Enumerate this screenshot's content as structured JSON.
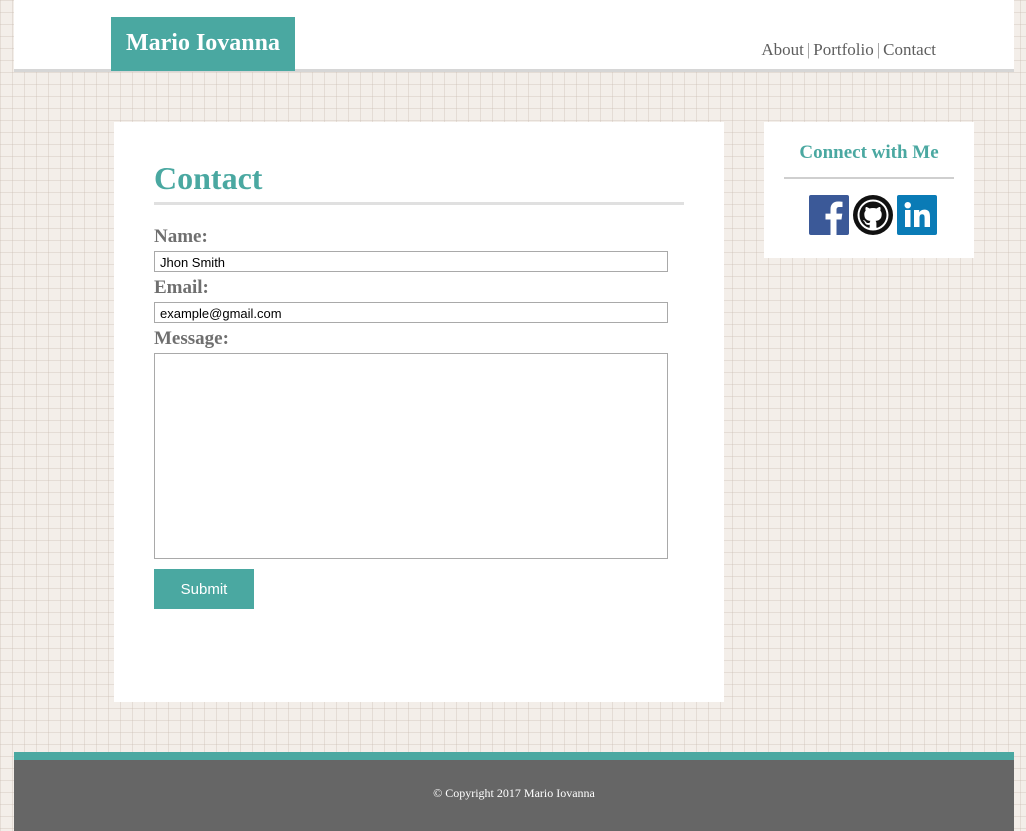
{
  "header": {
    "logo_text": "Mario Iovanna",
    "nav": {
      "about": "About",
      "portfolio": "Portfolio",
      "contact": "Contact",
      "separator": "|"
    }
  },
  "contact_form": {
    "title": "Contact",
    "name_label": "Name:",
    "name_value": "Jhon Smith",
    "email_label": "Email:",
    "email_value": "example@gmail.com",
    "message_label": "Message:",
    "message_value": "",
    "submit_label": "Submit"
  },
  "sidebar": {
    "title": "Connect with Me",
    "social": [
      {
        "icon": "facebook-icon",
        "color": "#3b5998"
      },
      {
        "icon": "github-icon",
        "color": "#111111"
      },
      {
        "icon": "linkedin-icon",
        "color": "#0a7bb6"
      }
    ]
  },
  "footer": {
    "copyright": "© Copyright 2017 Mario Iovanna"
  },
  "colors": {
    "accent": "#4aa8a1",
    "footer_bg": "#666666",
    "heading_gray": "#6f6f6f"
  }
}
